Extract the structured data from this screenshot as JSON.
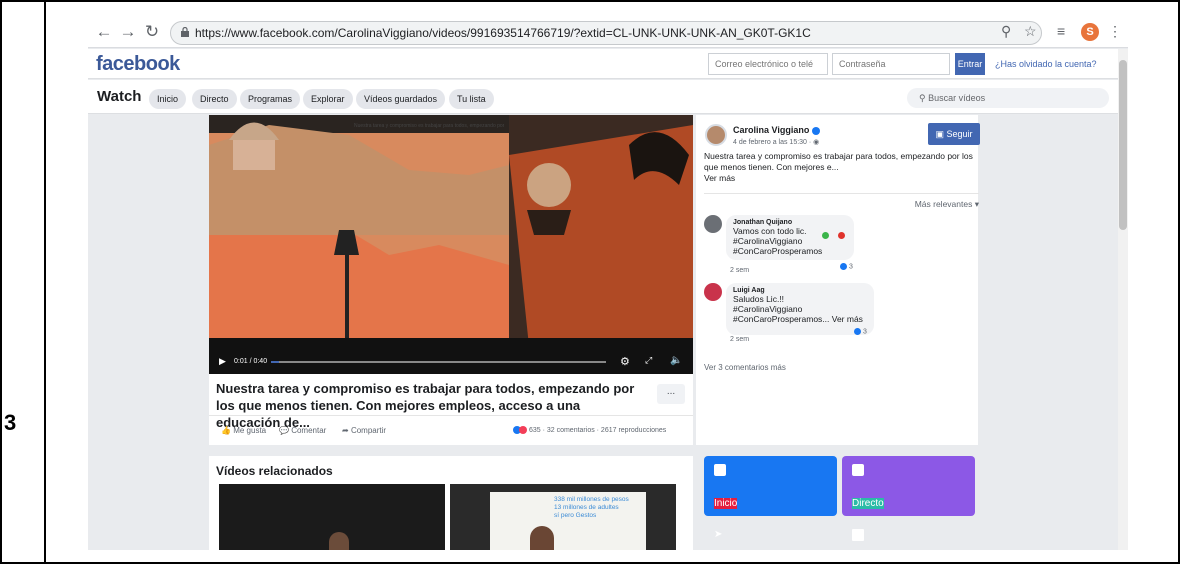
{
  "step": {
    "number": "3"
  },
  "browser": {
    "url": "https://www.facebook.com/CarolinaViggiano/videos/991693514766719/?extid=CL-UNK-UNK-UNK-AN_GK0T-GK1C",
    "profile_initial": "S"
  },
  "header": {
    "logo": "facebook",
    "email_placeholder": "Correo electrónico o telé",
    "password_placeholder": "Contraseña",
    "login_label": "Entrar",
    "forgot_label": "¿Has olvidado la cuenta?"
  },
  "watch": {
    "title": "Watch",
    "tabs": [
      "Inicio",
      "Directo",
      "Programas",
      "Explorar",
      "Vídeos guardados",
      "Tu lista"
    ],
    "search_placeholder": "Buscar vídeos"
  },
  "video": {
    "overlay_text": "Nuestra tarea y compromiso es trabajar para todos, empezando por los que menos tienen. Con mejores empleos, acceso a una educación de Calidad...",
    "time": "0:01 / 0:40",
    "progress": 0.025,
    "title": "Nuestra tarea y compromiso es trabajar para todos, empezando por los que menos tienen. Con mejores empleos, acceso a una educación de...",
    "more_label": "...",
    "like_label": "Me gusta",
    "comment_label": "Comentar",
    "share_label": "Compartir",
    "stats": "635 · 32 comentarios · 2617 reproducciones"
  },
  "post": {
    "author": "Carolina Viggiano",
    "time": "4 de febrero a las 15:30 · ",
    "follow_label": "Seguir",
    "text": "Nuestra tarea y compromiso es trabajar para todos, empezando por los que menos tienen. Con mejores e...",
    "see_more": "Ver más",
    "sort_label": "Más relevantes"
  },
  "comments": [
    {
      "name": "Jonathan Quijano",
      "body": "Vamos con todo lic. \n#CarolinaViggiano\n#ConCaroProsperamos",
      "time": "2 sem",
      "reactions": "3"
    },
    {
      "name": "Luigi Aag",
      "body": "Saludos Lic.!! \n#CarolinaViggiano\n#ConCaroProsperamos... Ver más",
      "time": "2 sem",
      "reactions": "3"
    }
  ],
  "more_comments": "Ver 3 comentarios más",
  "related": {
    "title": "Vídeos relacionados",
    "thumb_text": "338 mil millones de pesos\n13 millones de adultes\nsí pero Gestos"
  },
  "tiles": [
    {
      "label": "Inicio",
      "color": "#1877f2"
    },
    {
      "label": "Directo",
      "color": "#e41e3f"
    },
    {
      "label": "",
      "color": "#8c58e6"
    },
    {
      "label": "",
      "color": "#2abba7"
    }
  ]
}
